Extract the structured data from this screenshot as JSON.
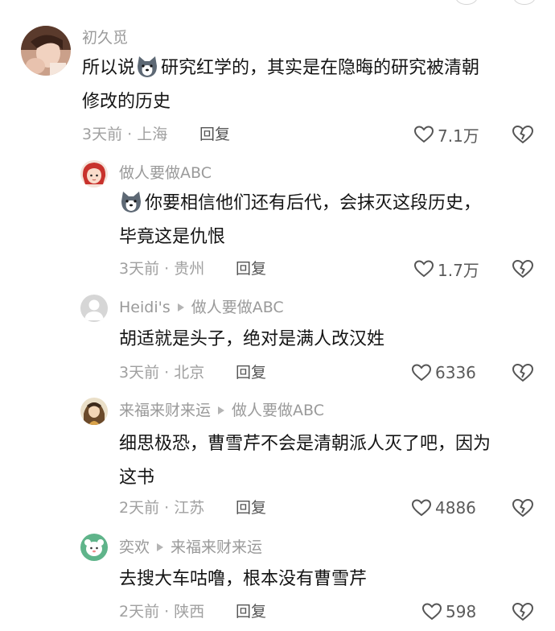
{
  "comments": [
    {
      "user": "初久觅",
      "text_lines": [
        "研究红学的，其实是在隐晦的研究被清朝",
        "修改的历史"
      ],
      "text_prefix": "所以说",
      "meta": "3天前 · 上海",
      "reply": "回复",
      "likes": "7.1万",
      "avatar_icon": "user-photo-avatar"
    },
    {
      "user": "做人要做ABC",
      "text_lines": [
        "你要相信他们还有后代，会抹灭这段历史，",
        "毕竟这是仇恨"
      ],
      "meta": "3天前 · 贵州",
      "reply": "回复",
      "likes": "1.7万",
      "avatar_icon": "cartoon-girl-avatar"
    },
    {
      "user": "Heidi's",
      "reply_to": "做人要做ABC",
      "text_lines": [
        "胡适就是头子，绝对是满人改汉姓"
      ],
      "meta": "3天前 · 北京",
      "reply": "回复",
      "likes": "6336",
      "avatar_icon": "default-user-avatar"
    },
    {
      "user": "来福来财来运",
      "reply_to": "做人要做ABC",
      "text_lines": [
        "细思极恐，曹雪芹不会是清朝派人灭了吧，因为",
        "这书"
      ],
      "meta": "2天前 · 江苏",
      "reply": "回复",
      "likes": "4886",
      "avatar_icon": "illustrated-avatar"
    },
    {
      "user": "奕欢",
      "reply_to": "来福来财来运",
      "text_lines": [
        "去搜大车咕噜，根本没有曹雪芹"
      ],
      "meta": "2天前 · 陕西",
      "reply": "回复",
      "likes": "598",
      "avatar_icon": "cute-animal-avatar"
    }
  ],
  "icons": [
    "husky-emoji-icon",
    "heart-icon",
    "broken-heart-icon",
    "reply-arrow-icon"
  ],
  "colors": {
    "text": "#141414",
    "meta": "#a0a0a0",
    "name": "#9a9a9a",
    "icon": "#555555"
  }
}
